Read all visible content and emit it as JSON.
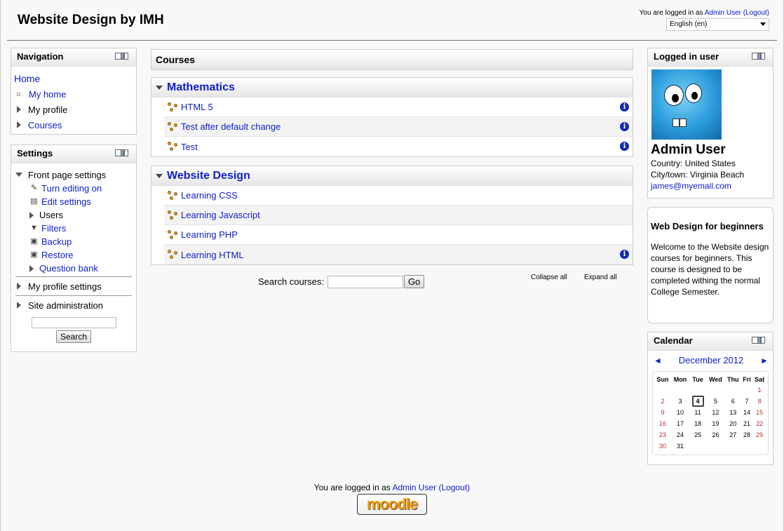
{
  "header": {
    "site_title": "Website Design by IMH",
    "logged_in_prefix": "You are logged in as",
    "user_name": "Admin User",
    "logout_label": "(Logout)",
    "language": "English (en)"
  },
  "navigation": {
    "title": "Navigation",
    "home": "Home",
    "items": [
      "My home",
      "My profile",
      "Courses"
    ]
  },
  "settings": {
    "title": "Settings",
    "front_page": "Front page settings",
    "items": [
      "Turn editing on",
      "Edit settings",
      "Users",
      "Filters",
      "Backup",
      "Restore",
      "Question bank"
    ],
    "my_profile_settings": "My profile settings",
    "site_administration": "Site administration",
    "search_button": "Search"
  },
  "courses": {
    "title": "Courses",
    "categories": [
      {
        "name": "Mathematics",
        "courses": [
          "HTML 5",
          "Test after default change",
          "Test"
        ]
      },
      {
        "name": "Website Design",
        "courses": [
          "Learning CSS",
          "Learning Javascript",
          "Learning PHP",
          "Learning HTML"
        ]
      }
    ],
    "search_label": "Search courses:",
    "go_button": "Go",
    "collapse_all": "Collapse all",
    "expand_all": "Expand all"
  },
  "logged_in_user": {
    "title": "Logged in user",
    "name": "Admin User",
    "country": "Country: United States",
    "city": "City/town: Virginia Beach",
    "email": "james@myemail.com"
  },
  "html_block": {
    "title": "Web Design for beginners",
    "body": "Welcome to the Website design courses for beginners. This course is designed to be completed withing the normal College Semester."
  },
  "calendar": {
    "title": "Calendar",
    "month": "December 2012",
    "prev": "◄",
    "next": "►",
    "days": [
      "Sun",
      "Mon",
      "Tue",
      "Wed",
      "Thu",
      "Fri",
      "Sat"
    ],
    "weeks": [
      [
        "",
        "",
        "",
        "",
        "",
        "",
        "1"
      ],
      [
        "2",
        "3",
        "4",
        "5",
        "6",
        "7",
        "8"
      ],
      [
        "9",
        "10",
        "11",
        "12",
        "13",
        "14",
        "15"
      ],
      [
        "16",
        "17",
        "18",
        "19",
        "20",
        "21",
        "22"
      ],
      [
        "23",
        "24",
        "25",
        "26",
        "27",
        "28",
        "29"
      ],
      [
        "30",
        "31",
        "",
        "",
        "",
        "",
        ""
      ]
    ],
    "today": "4"
  },
  "footer": {
    "logged_in_prefix": "You are logged in as",
    "user_name": "Admin User",
    "logout_label": "(Logout)",
    "logo_text": "moodle"
  },
  "colors": {
    "link": "#1020c8",
    "info_icon": "#1428b4",
    "weekend": "#b03030"
  }
}
